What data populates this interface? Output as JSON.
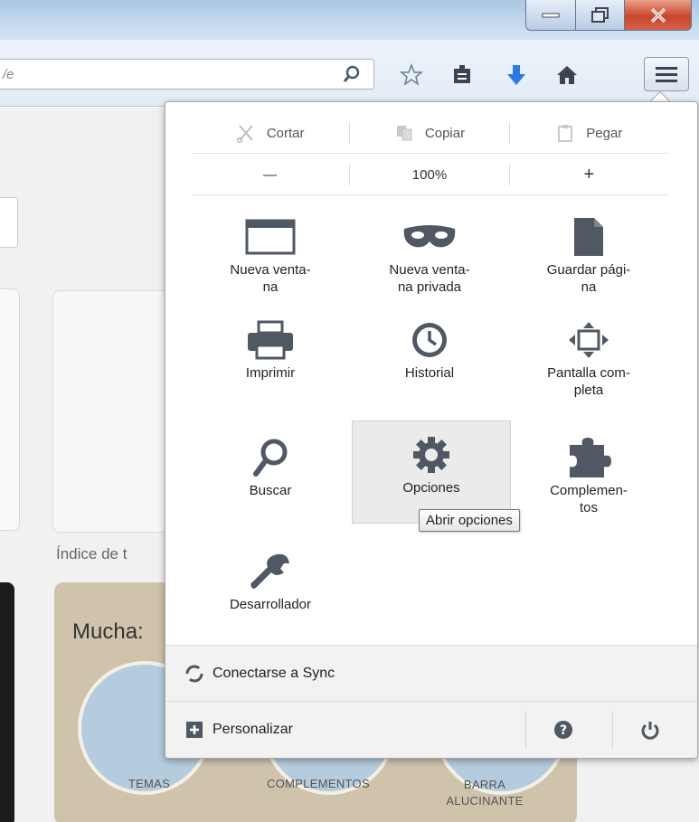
{
  "toolbar": {
    "url_text": "/e"
  },
  "page": {
    "indice_text": "Índice de t",
    "mucha_text": "Mucha:",
    "bottom_labels": [
      "TEMAS",
      "COMPLEMENTOS",
      "BARRA\nALUCINANTE"
    ]
  },
  "menu": {
    "edit": {
      "cut": "Cortar",
      "copy": "Copiar",
      "paste": "Pegar"
    },
    "zoom": {
      "minus": "—",
      "level": "100%",
      "plus": "+"
    },
    "items": [
      {
        "label": "Nueva venta-\nna",
        "icon": "new-window-icon"
      },
      {
        "label": "Nueva venta-\nna privada",
        "icon": "private-mask-icon"
      },
      {
        "label": "Guardar pági-\nna",
        "icon": "save-page-icon"
      },
      {
        "label": "Imprimir",
        "icon": "printer-icon"
      },
      {
        "label": "Historial",
        "icon": "clock-icon"
      },
      {
        "label": "Pantalla com-\npleta",
        "icon": "fullscreen-icon"
      },
      {
        "label": "Buscar",
        "icon": "search-icon"
      },
      {
        "label": "Opciones",
        "icon": "gear-icon"
      },
      {
        "label": "Complemen-\ntos",
        "icon": "puzzle-icon"
      },
      {
        "label": "Desarrollador",
        "icon": "wrench-icon"
      }
    ],
    "tooltip": "Abrir opciones",
    "sync": "Conectarse a Sync",
    "customize": "Personalizar"
  }
}
